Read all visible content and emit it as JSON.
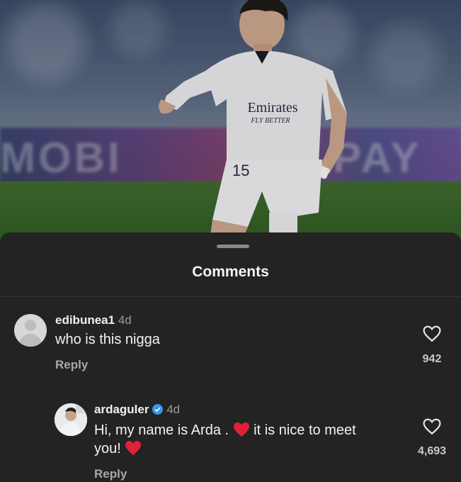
{
  "sheet": {
    "title": "Comments"
  },
  "comments": [
    {
      "username": "edibunea1",
      "time": "4d",
      "text": "who is this nigga",
      "reply_label": "Reply",
      "likes": "942",
      "avatar": "default-avatar-icon"
    },
    {
      "username": "ardaguler",
      "time": "4d",
      "verified": true,
      "text_part1": "Hi, my name is Arda . ",
      "text_part2": " it is nice to meet",
      "text_part3": "you! ",
      "reply_label": "Reply",
      "likes": "4,693",
      "avatar": "profile-photo"
    }
  ],
  "photo": {
    "shirt_sponsor": "Emirates",
    "shirt_tagline": "FLY BETTER",
    "shirt_number": "15"
  },
  "colors": {
    "sheet_bg": "#232323",
    "verified": "#3897f0",
    "heart_red": "#e0203a",
    "secondary_text": "#a8a8a8"
  }
}
